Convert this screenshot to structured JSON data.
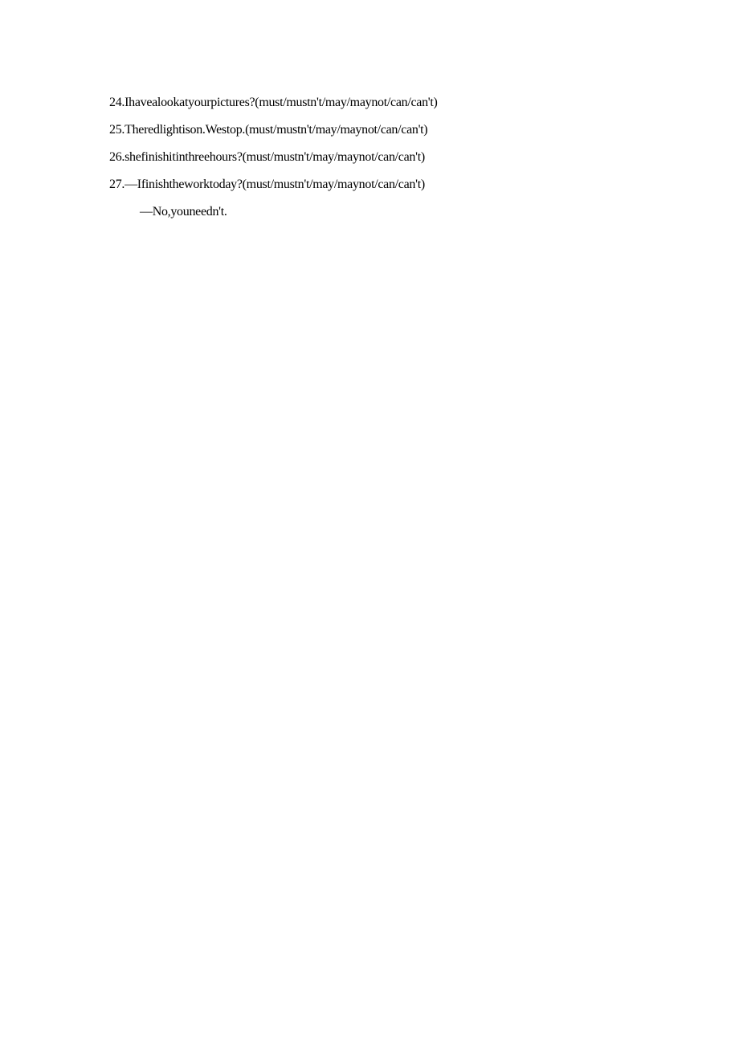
{
  "lines": [
    {
      "text": "24.Ihavealookatyourpictures?(must/mustn't/may/maynot/can/can't)",
      "indent": false
    },
    {
      "text": "25.Theredlightison.Westop.(must/mustn't/may/maynot/can/can't)",
      "indent": false
    },
    {
      "text": "26.shefinishitinthreehours?(must/mustn't/may/maynot/can/can't)",
      "indent": false
    },
    {
      "text": "27.—Ifinishtheworktoday?(must/mustn't/may/maynot/can/can't)",
      "indent": false
    },
    {
      "text": "—No,youneedn't.",
      "indent": true
    }
  ]
}
